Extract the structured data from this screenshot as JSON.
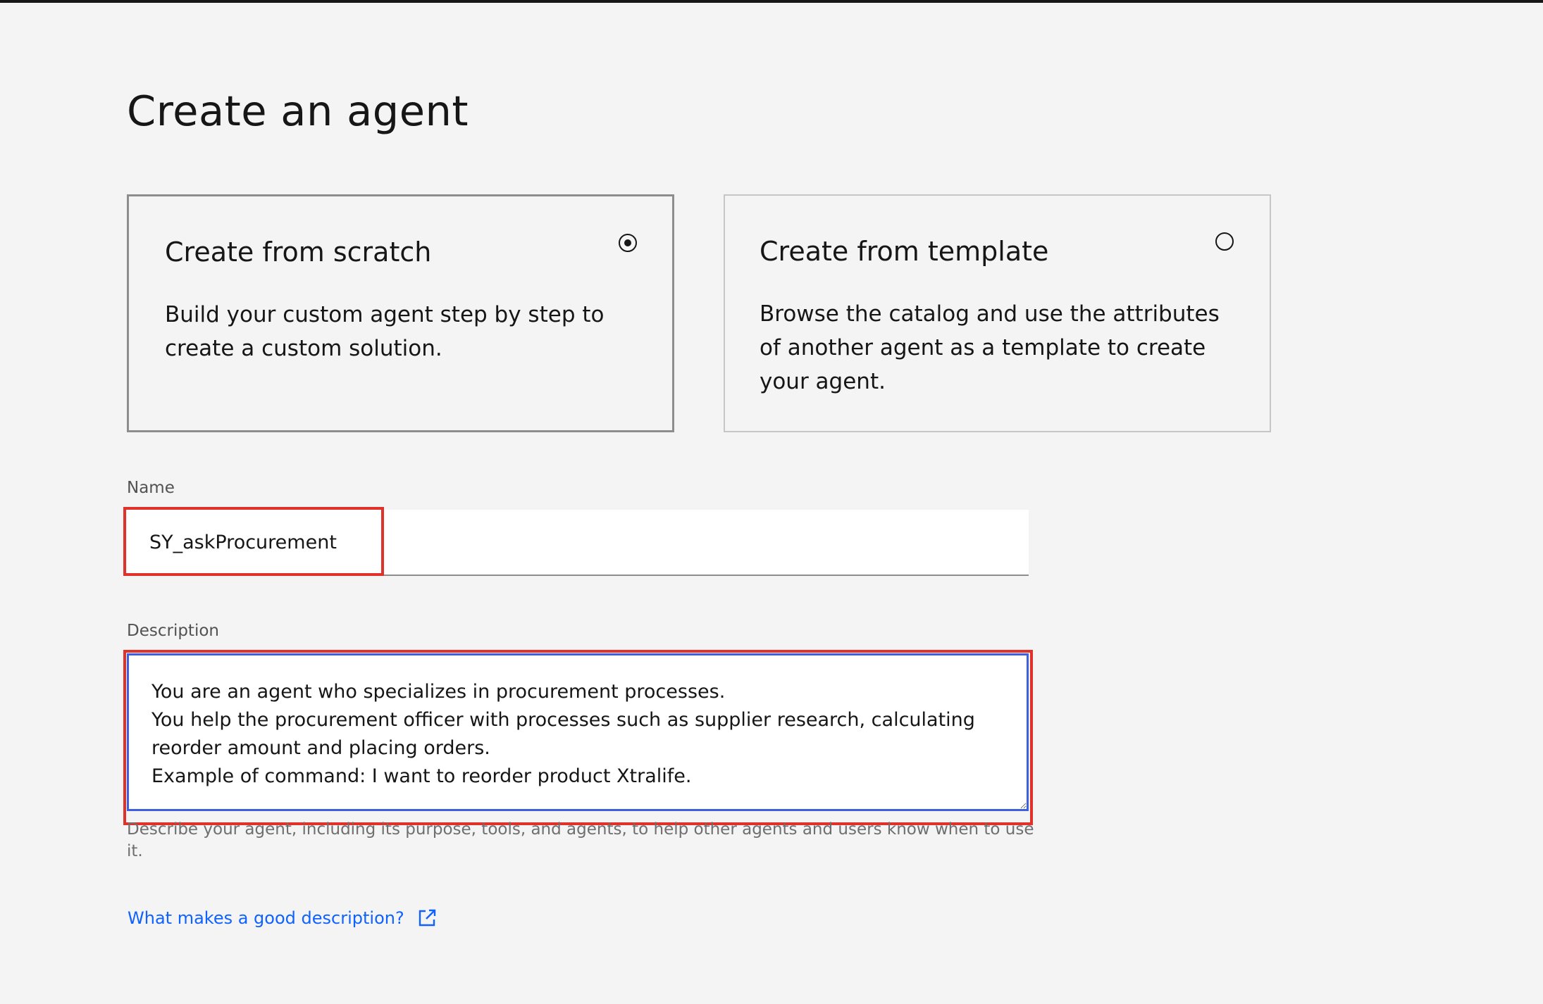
{
  "page": {
    "title": "Create an agent"
  },
  "options": {
    "scratch": {
      "title": "Create from scratch",
      "description": "Build your custom agent step by step to create a custom solution.",
      "selected": true
    },
    "template": {
      "title": "Create from template",
      "description": "Browse the catalog and use the attributes of another agent as a template to create your agent.",
      "selected": false
    }
  },
  "form": {
    "name_label": "Name",
    "name_value": "SY_askProcurement",
    "description_label": "Description",
    "description_value": "You are an agent who specializes in procurement processes.\nYou help the procurement officer with processes such as supplier research, calculating reorder amount and placing orders.\nExample of command: I want to reorder product Xtralife.",
    "description_helper": "Describe your agent, including its purpose, tools, and agents, to help other agents and users know when to use it.",
    "help_link_label": "What makes a good description?"
  },
  "colors": {
    "background": "#f4f4f4",
    "link": "#0f62fe",
    "focus": "#3d5fe0",
    "highlight": "#e0322a"
  },
  "icons": {
    "external_link": "external-link-icon"
  }
}
